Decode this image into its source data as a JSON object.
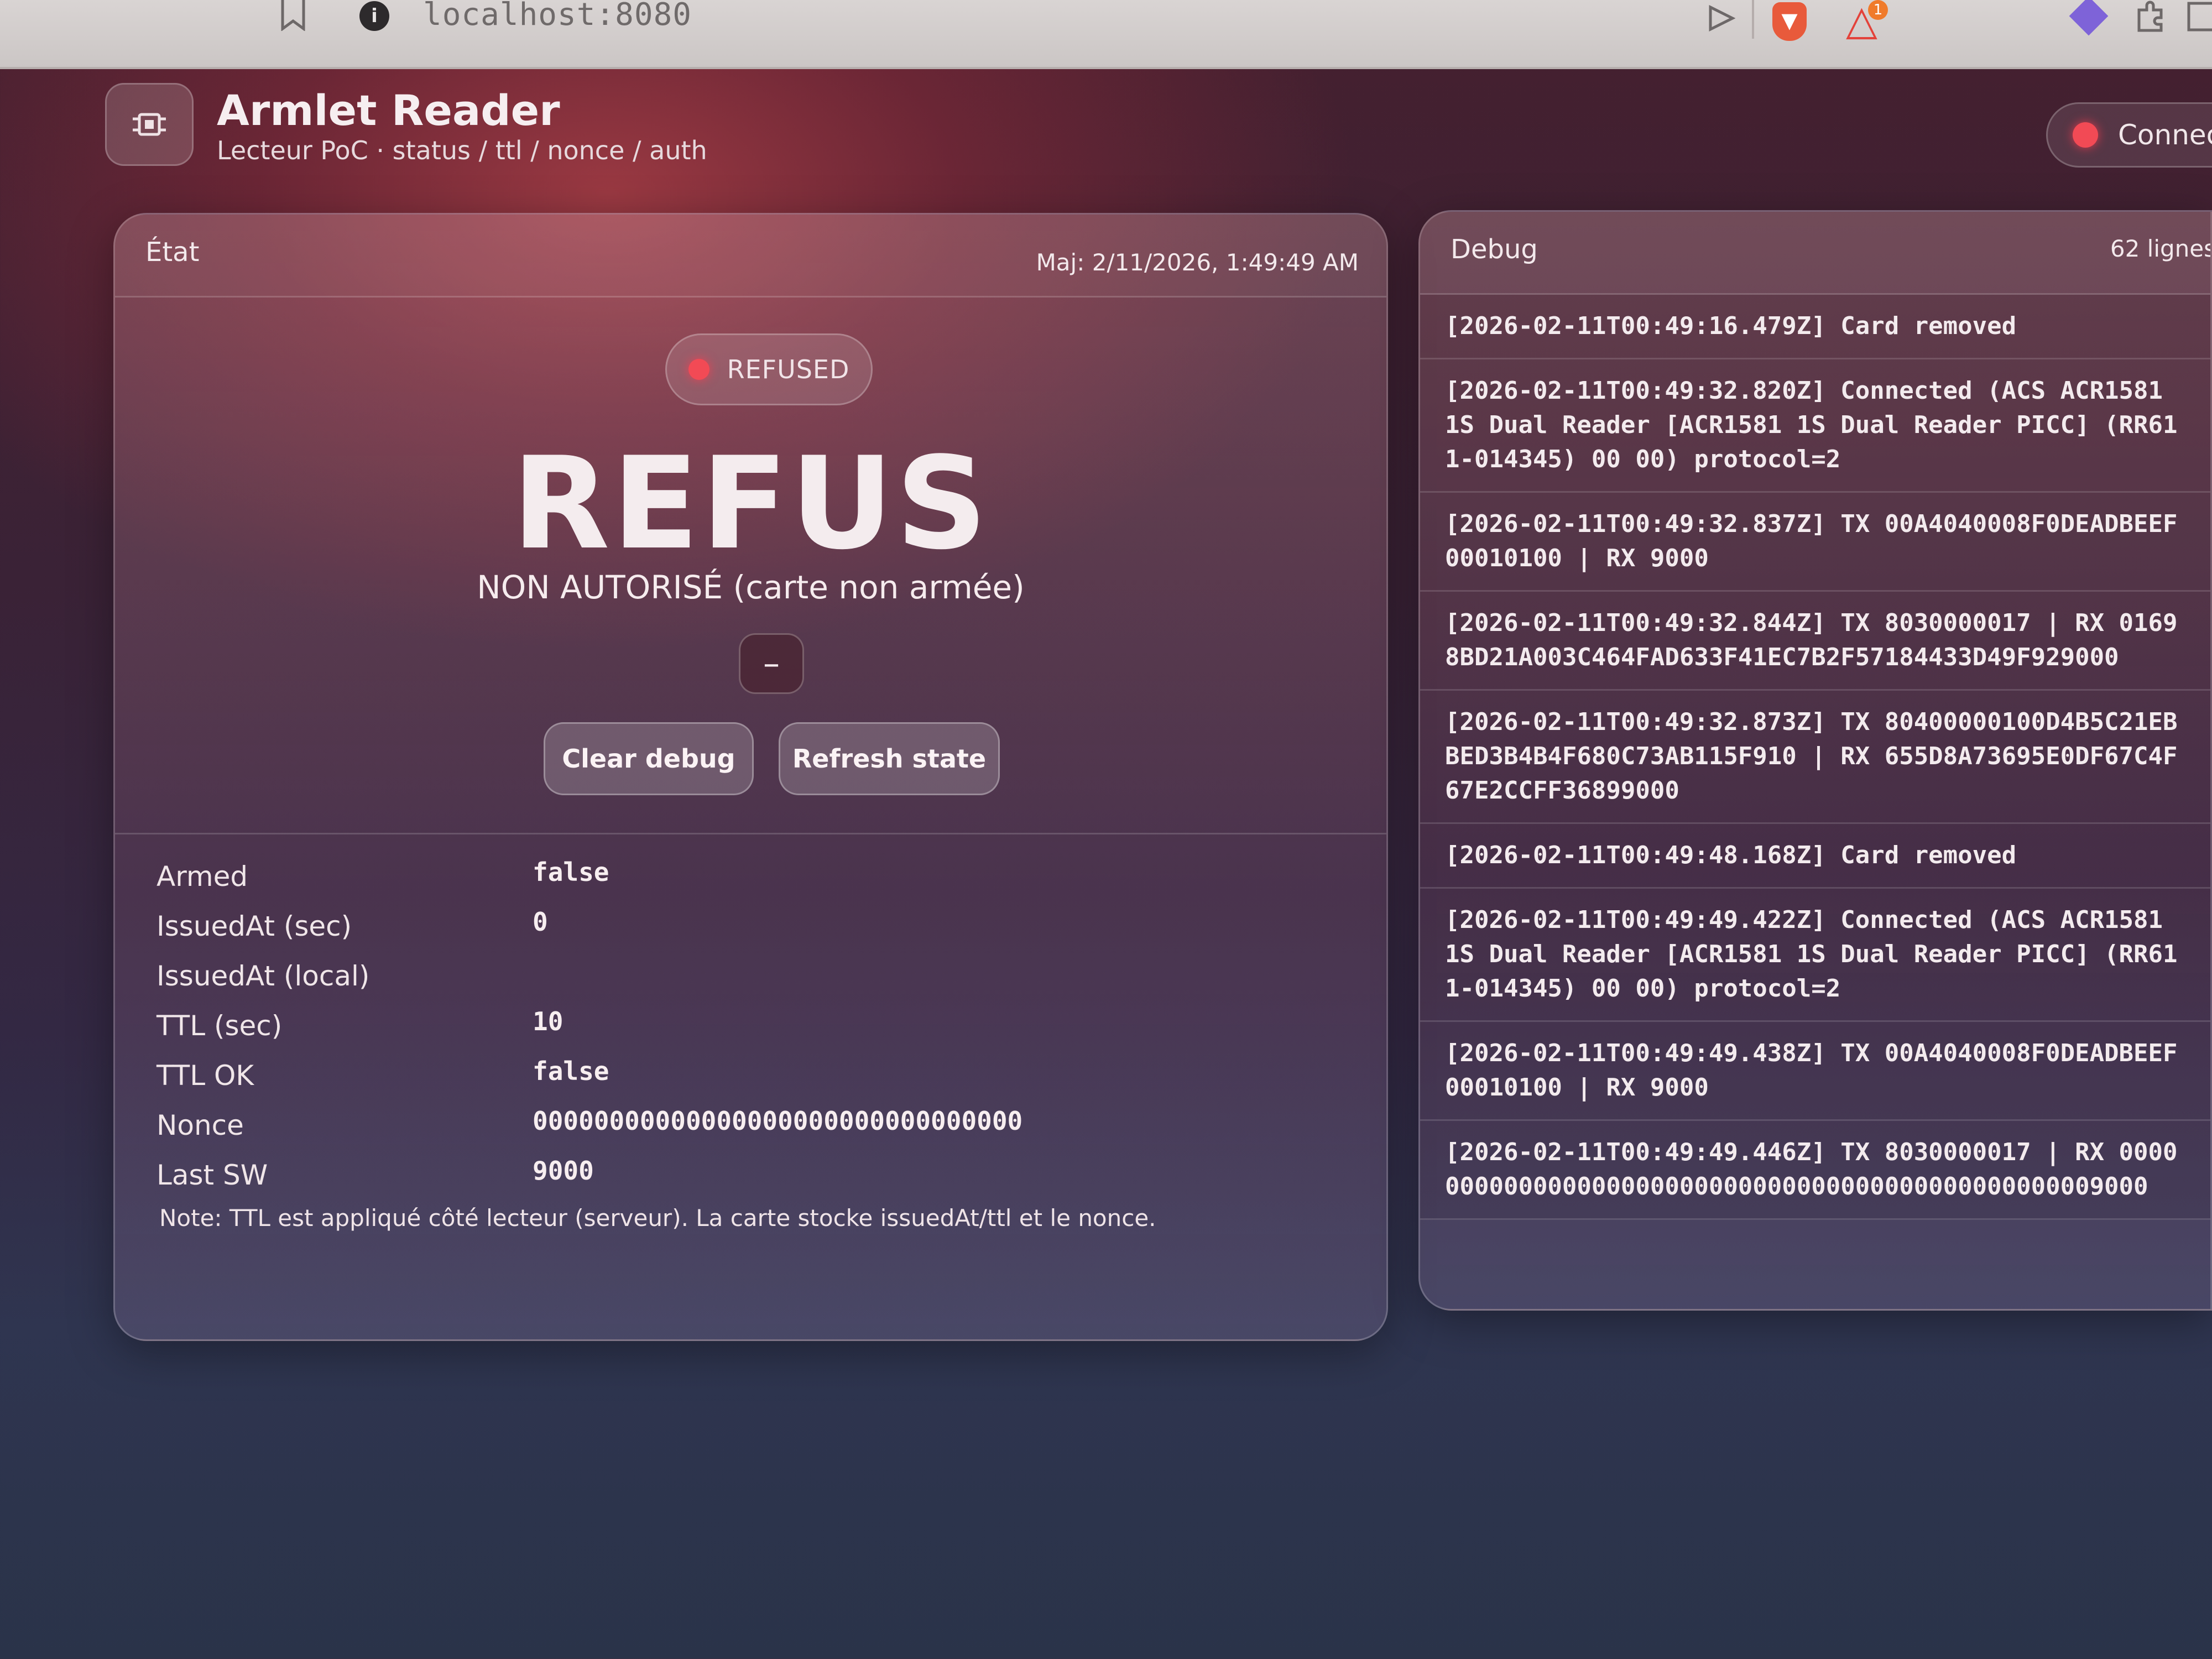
{
  "browser": {
    "url": "localhost:8080",
    "ext_badge": "1"
  },
  "app": {
    "title": "Armlet Reader",
    "subtitle": "Lecteur PoC · status / ttl / nonce / auth",
    "connection_label": "Connect"
  },
  "state": {
    "title": "État",
    "updated": "Maj: 2/11/2026, 1:49:49 AM",
    "status_badge": "REFUSED",
    "verdict": "REFUS",
    "verdict_detail": "NON AUTORISÉ (carte non armée)",
    "dash_label": "–",
    "clear_debug_label": "Clear debug",
    "refresh_state_label": "Refresh state",
    "fields": [
      {
        "key": "Armed",
        "value": "false"
      },
      {
        "key": "IssuedAt (sec)",
        "value": "0"
      },
      {
        "key": "IssuedAt (local)",
        "value": ""
      },
      {
        "key": "TTL (sec)",
        "value": "10"
      },
      {
        "key": "TTL OK",
        "value": "false"
      },
      {
        "key": "Nonce",
        "value": "00000000000000000000000000000000"
      },
      {
        "key": "Last SW",
        "value": "9000"
      }
    ],
    "note": "Note: TTL est appliqué côté lecteur (serveur). La carte stocke issuedAt/ttl et le nonce."
  },
  "debug": {
    "title": "Debug",
    "line_count": "62 lignes",
    "entries": [
      "[2026-02-11T00:49:16.479Z] Card removed",
      "[2026-02-11T00:49:32.820Z] Connected (ACS ACR1581 1S Dual Reader [ACR1581 1S Dual Reader PICC] (RR611-014345) 00 00) protocol=2",
      "[2026-02-11T00:49:32.837Z] TX 00A4040008F0DEADBEEF00010100 | RX 9000",
      "[2026-02-11T00:49:32.844Z] TX 8030000017 | RX 01698BD21A003C464FAD633F41EC7B2F57184433D49F929000",
      "[2026-02-11T00:49:32.873Z] TX 80400000100D4B5C21EBBED3B4B4F680C73AB115F910 | RX 655D8A73695E0DF67C4F67E2CCFF36899000",
      "[2026-02-11T00:49:48.168Z] Card removed",
      "[2026-02-11T00:49:49.422Z] Connected (ACS ACR1581 1S Dual Reader [ACR1581 1S Dual Reader PICC] (RR611-014345) 00 00) protocol=2",
      "[2026-02-11T00:49:49.438Z] TX 00A4040008F0DEADBEEF00010100 | RX 9000",
      "[2026-02-11T00:49:49.446Z] TX 8030000017 | RX 0000000000000000000000000000000000000000000000009000"
    ]
  }
}
